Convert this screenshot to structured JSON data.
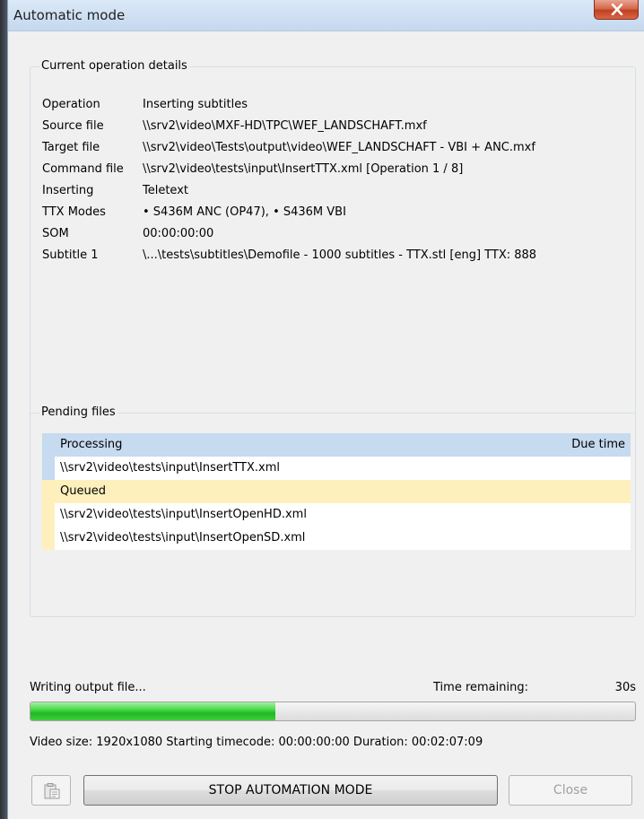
{
  "window": {
    "title": "Automatic mode"
  },
  "details": {
    "legend": "Current operation details",
    "rows": [
      {
        "key": "Operation",
        "value": "Inserting subtitles"
      },
      {
        "key": "Source file",
        "value": "\\\\srv2\\video\\MXF-HD\\TPC\\WEF_LANDSCHAFT.mxf"
      },
      {
        "key": "Target file",
        "value": "\\\\srv2\\video\\Tests\\output\\video\\WEF_LANDSCHAFT - VBI + ANC.mxf"
      },
      {
        "key": "Command file",
        "value": "\\\\srv2\\video\\tests\\input\\InsertTTX.xml [Operation 1 / 8]"
      },
      {
        "key": "Inserting",
        "value": "Teletext"
      },
      {
        "key": "TTX Modes",
        "value": "• S436M ANC (OP47), • S436M VBI"
      },
      {
        "key": "SOM",
        "value": "00:00:00:00"
      },
      {
        "key": "Subtitle 1",
        "value": "\\...\\tests\\subtitles\\Demofile - 1000 subtitles - TTX.stl [eng] TTX: 888"
      }
    ]
  },
  "pending": {
    "legend": "Pending files",
    "processing_label": "Processing",
    "due_time_label": "Due time",
    "processing_items": [
      "\\\\srv2\\video\\tests\\input\\InsertTTX.xml"
    ],
    "queued_label": "Queued",
    "queued_items": [
      "\\\\srv2\\video\\tests\\input\\InsertOpenHD.xml",
      "\\\\srv2\\video\\tests\\input\\InsertOpenSD.xml"
    ]
  },
  "status": {
    "text": "Writing output file...",
    "time_remaining_label": "Time remaining:",
    "time_remaining_value": "30s",
    "progress_fraction": 0.405,
    "info": "Video size: 1920x1080  Starting timecode: 00:00:00:00  Duration: 00:02:07:09"
  },
  "buttons": {
    "stop_label": "STOP AUTOMATION MODE",
    "close_label": "Close"
  },
  "icons": {
    "close": "close-icon",
    "clipboard": "clipboard-icon"
  },
  "colors": {
    "processing_header": "#c6daf0",
    "queued_header": "#fdf0bd",
    "progress_fill": "#1fb823",
    "close_button": "#c1401f"
  }
}
